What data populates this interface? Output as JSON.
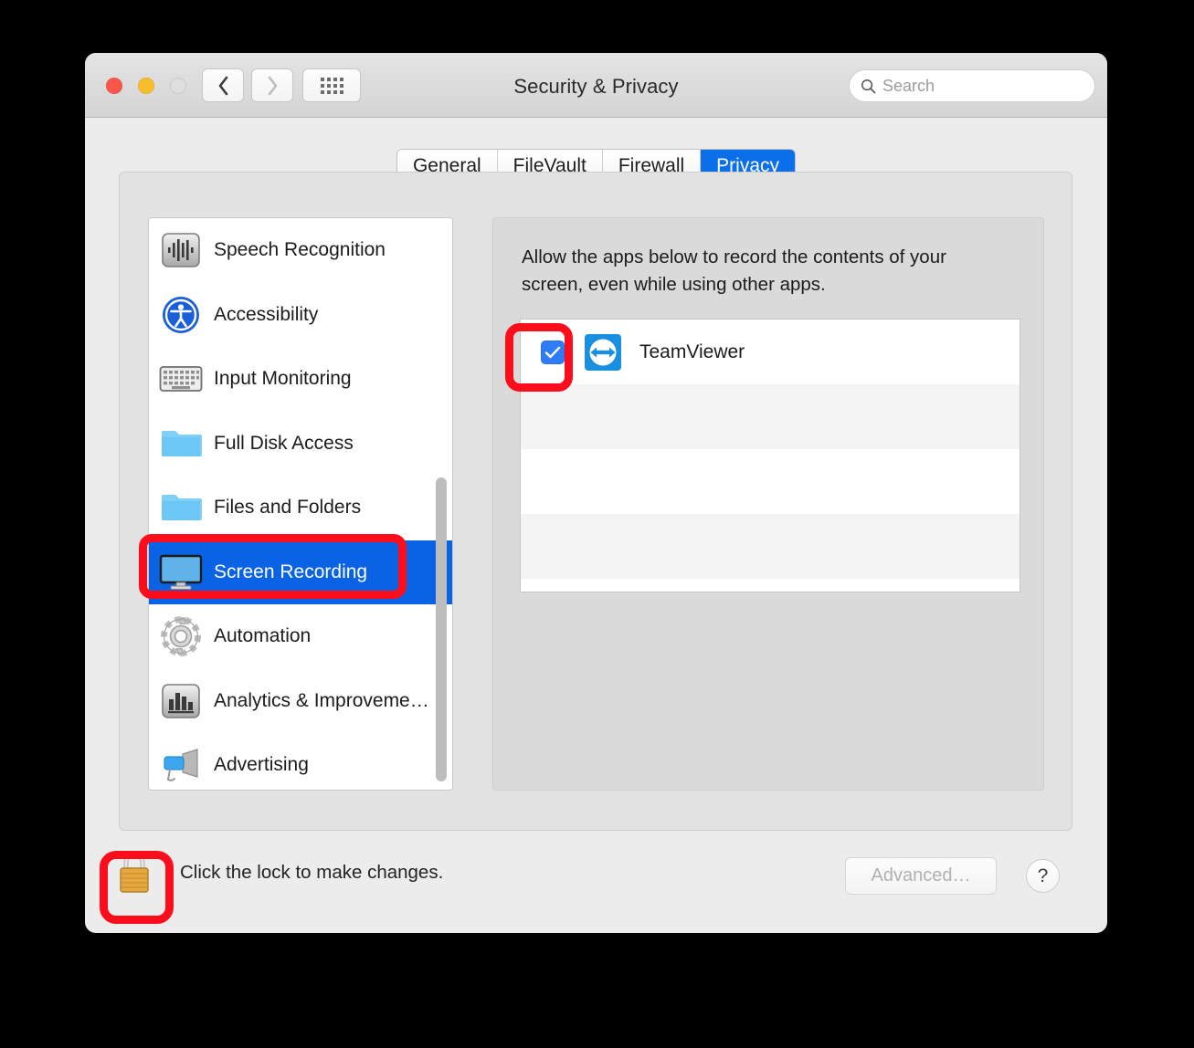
{
  "window": {
    "title": "Security & Privacy",
    "traffic_lights": [
      "close-button",
      "minimize-button",
      "zoom-button-disabled"
    ]
  },
  "toolbar": {
    "back_label": "Back",
    "forward_label": "Forward",
    "grid_label": "Show All",
    "search": {
      "placeholder": "Search",
      "value": "",
      "icon": "search-icon"
    }
  },
  "tabs": [
    {
      "label": "General",
      "active": false
    },
    {
      "label": "FileVault",
      "active": false
    },
    {
      "label": "Firewall",
      "active": false
    },
    {
      "label": "Privacy",
      "active": true
    }
  ],
  "sidebar": {
    "items": [
      {
        "label": "Speech Recognition",
        "icon": "waveform-icon",
        "selected": false
      },
      {
        "label": "Accessibility",
        "icon": "accessibility-icon",
        "selected": false
      },
      {
        "label": "Input Monitoring",
        "icon": "keyboard-icon",
        "selected": false
      },
      {
        "label": "Full Disk Access",
        "icon": "folder-icon",
        "selected": false
      },
      {
        "label": "Files and Folders",
        "icon": "folder-icon",
        "selected": false
      },
      {
        "label": "Screen Recording",
        "icon": "display-icon",
        "selected": true
      },
      {
        "label": "Automation",
        "icon": "gear-icon",
        "selected": false
      },
      {
        "label": "Analytics & Improveme…",
        "icon": "bar-chart-icon",
        "selected": false
      },
      {
        "label": "Advertising",
        "icon": "megaphone-icon",
        "selected": false
      }
    ],
    "scrollbar_visible": true
  },
  "detail": {
    "description": "Allow the apps below to record the contents of your screen, even while using other apps.",
    "apps": [
      {
        "name": "TeamViewer",
        "checked": true,
        "icon": "teamviewer-icon"
      }
    ],
    "empty_rows": 3
  },
  "bottom": {
    "lock_icon": "lock-closed-icon",
    "lock_text": "Click the lock to make changes.",
    "advanced_label": "Advanced…",
    "advanced_enabled": false,
    "help_label": "?"
  },
  "annotations": {
    "highlight_color": "#FC0D1B",
    "targets": [
      "screen-recording-row",
      "teamviewer-checkbox",
      "lock-button"
    ]
  },
  "colors": {
    "selection_blue": "#0A63E4",
    "tab_active_blue": "#0A6FE8",
    "checkbox_blue": "#2F7CF6",
    "window_bg": "#ECECEC",
    "panel_bg": "#DADADA"
  }
}
